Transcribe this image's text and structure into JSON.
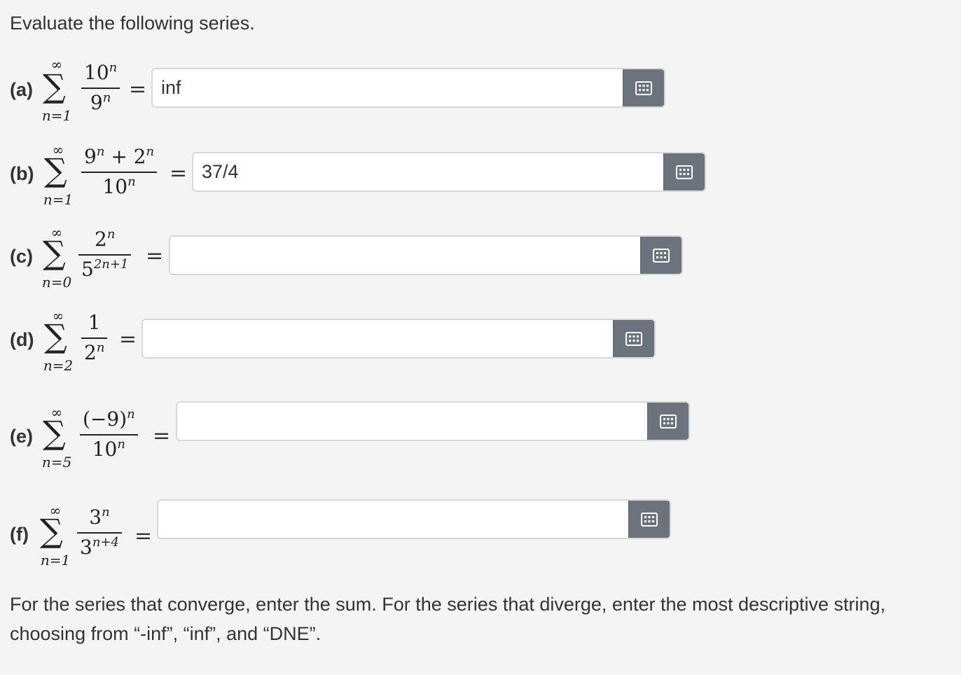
{
  "title": "Evaluate the following series.",
  "problems": [
    {
      "label": "(a)",
      "upper": "∞",
      "lower": "n=1",
      "answer": "inf"
    },
    {
      "label": "(b)",
      "upper": "∞",
      "lower": "n=1",
      "answer": "37/4"
    },
    {
      "label": "(c)",
      "upper": "∞",
      "lower": "n=0",
      "answer": ""
    },
    {
      "label": "(d)",
      "upper": "∞",
      "lower": "n=2",
      "answer": ""
    },
    {
      "label": "(e)",
      "upper": "∞",
      "lower": "n=5",
      "answer": ""
    },
    {
      "label": "(f)",
      "upper": "∞",
      "lower": "n=1",
      "answer": ""
    }
  ],
  "equals": "=",
  "keyboard_icon": "grid-keyboard-icon",
  "colors": {
    "button": "#6c737d",
    "background": "#f4f4f4"
  },
  "footer": "For the series that converge, enter the sum. For the series that diverge, enter the most descriptive string, choosing from “-inf”, “inf”, and “DNE”."
}
